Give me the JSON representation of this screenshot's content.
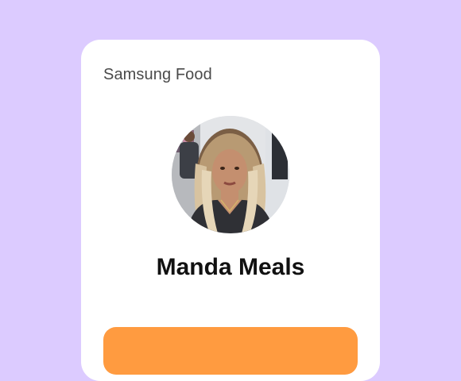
{
  "card": {
    "brand": "Samsung Food",
    "profile_name": "Manda Meals",
    "cta_label": ""
  },
  "colors": {
    "background": "#dccbff",
    "card": "#ffffff",
    "cta": "#ff9b40",
    "name_text": "#111111",
    "brand_text": "#4a4a4a"
  }
}
